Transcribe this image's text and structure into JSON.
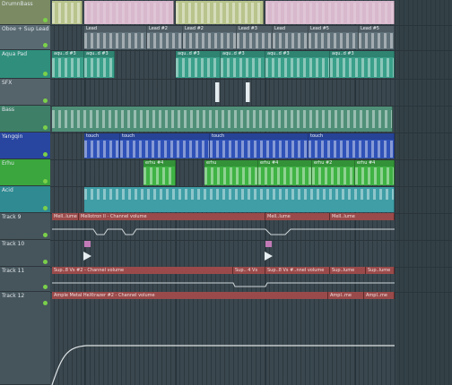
{
  "tracks": [
    {
      "name": "DrumnBass",
      "color": "#7b8a62"
    },
    {
      "name": "Oboe + Sup Lead",
      "color": "#5a6a72"
    },
    {
      "name": "Aqua Pad",
      "color": "#2f8f7c"
    },
    {
      "name": "SFX",
      "color": "#55636a"
    },
    {
      "name": "Bass",
      "color": "#3e7f68"
    },
    {
      "name": "Yangqin",
      "color": "#2846a0"
    },
    {
      "name": "Erhu",
      "color": "#3aa63d"
    },
    {
      "name": "Acid",
      "color": "#2f8a92"
    },
    {
      "name": "Track 9",
      "color": "#46555c"
    },
    {
      "name": "Track 10",
      "color": "#46555c"
    },
    {
      "name": "Track 11",
      "color": "#46555c"
    },
    {
      "name": "Track 12",
      "color": "#46555c"
    }
  ],
  "clips": {
    "lead": [
      "Lead",
      "Lead #2",
      "Lead #2",
      "Lead #3",
      "Lead",
      "Lead #5",
      "Lead #5"
    ],
    "aqua": [
      "aqu..d #3",
      "aqu..d #3",
      "aqu..d #3",
      "aqu..d #3",
      "aqu..d #3",
      "aqu..d #3"
    ],
    "yangqin": [
      "touch",
      "touch",
      "touch",
      "touch"
    ],
    "erhu": [
      "erhu #4",
      "erhu",
      "erhu #4",
      "erhu #2",
      "erhu #4"
    ]
  },
  "automation": {
    "track9": [
      "Mell..lume",
      "Mellotron II - Channel volume",
      "Mell..lume",
      "Mell..lume"
    ],
    "track11": [
      "Sup..8 Vs #2 - Channel volume",
      "Sup.. 4 Vs",
      "Sup..8 Vs #..nnel volume",
      "Sup..lume",
      "Sup..lume"
    ],
    "track12": [
      "Ample Metal HeXtrazer #2 - Channel volume",
      "Ampl..me",
      "Ampl..me"
    ]
  }
}
